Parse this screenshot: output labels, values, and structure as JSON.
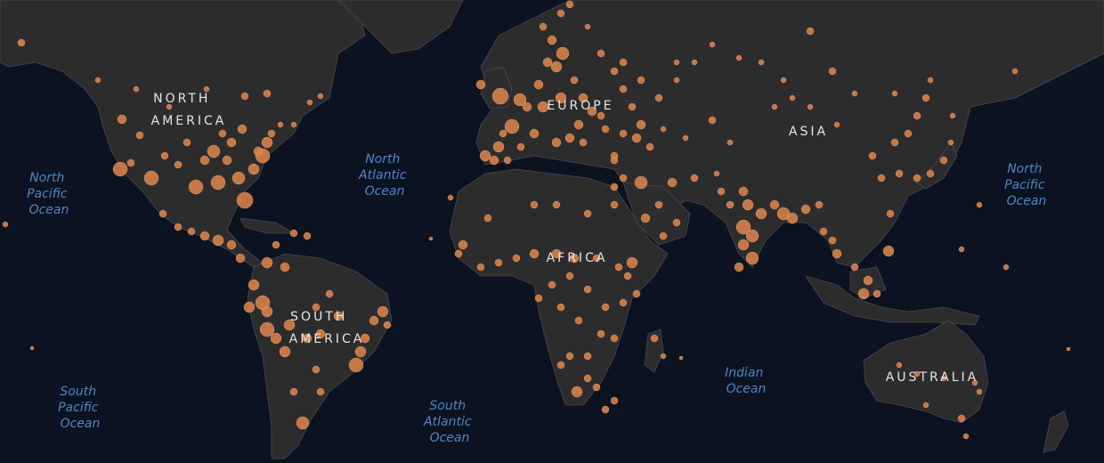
{
  "map": {
    "continent_labels": [
      {
        "id": "north-america",
        "lines": [
          "NORTH",
          "AMERICA"
        ]
      },
      {
        "id": "south-america",
        "lines": [
          "SOUTH",
          "AMERICA"
        ]
      },
      {
        "id": "europe",
        "lines": [
          "EUROPE"
        ]
      },
      {
        "id": "asia",
        "lines": [
          "ASIA"
        ]
      },
      {
        "id": "africa",
        "lines": [
          "AFRICA"
        ]
      },
      {
        "id": "australia",
        "lines": [
          "AUSTRALIA"
        ]
      }
    ],
    "ocean_labels": [
      {
        "id": "north-pacific-west",
        "lines": [
          "North",
          "Pacific",
          "Ocean"
        ]
      },
      {
        "id": "north-atlantic",
        "lines": [
          "North",
          "Atlantic",
          "Ocean"
        ]
      },
      {
        "id": "north-pacific-east",
        "lines": [
          "North",
          "Pacific",
          "Ocean"
        ]
      },
      {
        "id": "south-pacific",
        "lines": [
          "South",
          "Pacific",
          "Ocean"
        ]
      },
      {
        "id": "south-atlantic",
        "lines": [
          "South",
          "Atlantic",
          "Ocean"
        ]
      },
      {
        "id": "indian",
        "lines": [
          "Indian",
          "Ocean"
        ]
      }
    ],
    "colors": {
      "ocean": "#0b1220",
      "land": "#2c2c2c",
      "border": "#4a4755",
      "marker": "#d9834b",
      "continent_text": "#e6e6e6",
      "ocean_text": "#4f86c6"
    }
  }
}
